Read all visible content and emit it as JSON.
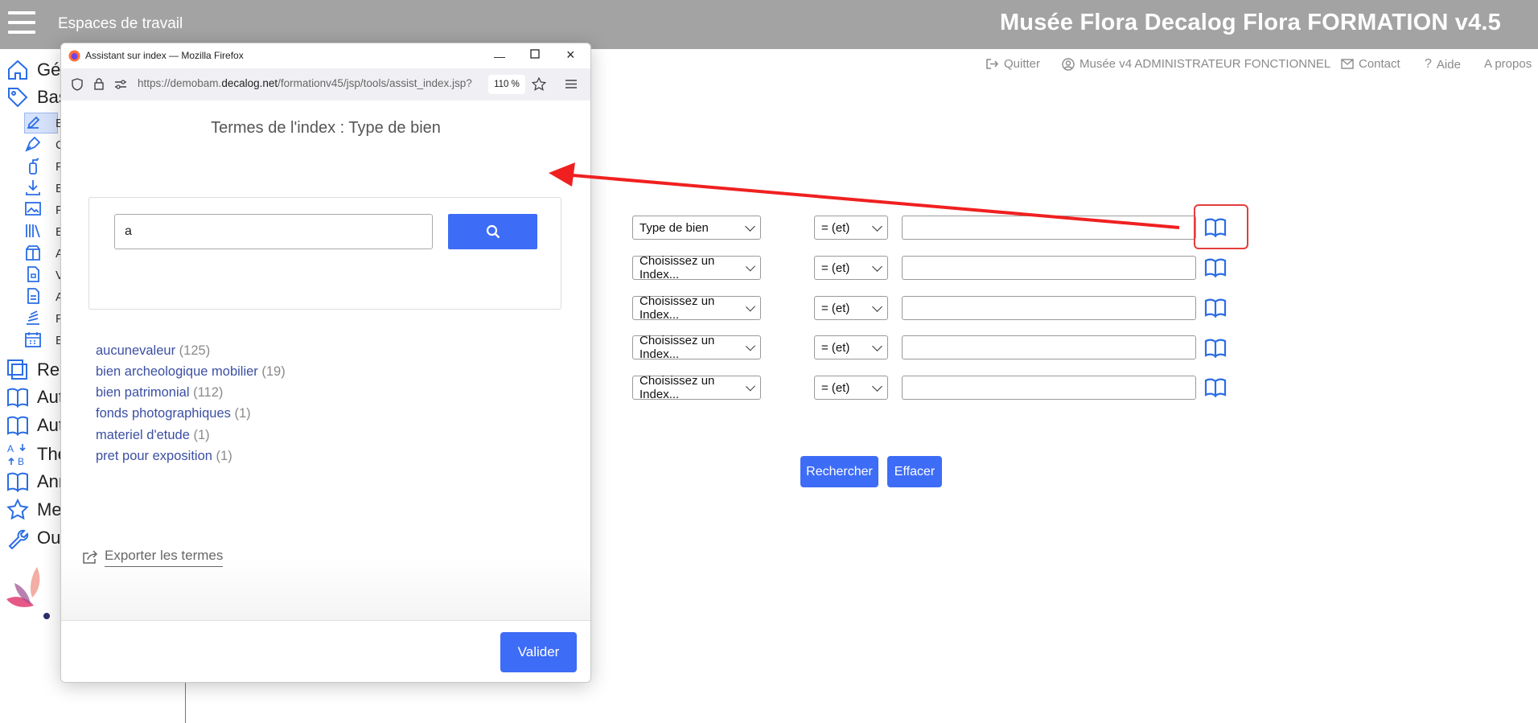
{
  "header": {
    "workspaces_label": "Espaces de travail",
    "app_title": "Musée Flora Decalog Flora FORMATION v4.5"
  },
  "toplinks": {
    "quit": "Quitter",
    "user": "Musée v4 ADMINISTRATEUR FONCTIONNEL",
    "contact": "Contact",
    "help": "Aide",
    "about": "A propos"
  },
  "sidebar": {
    "items": [
      {
        "label": "Gén",
        "icon": "home-icon"
      },
      {
        "label": "Bas",
        "icon": "tag-icon"
      },
      {
        "label": "Reg",
        "icon": "registers-icon"
      },
      {
        "label": "Aut",
        "icon": "book-icon"
      },
      {
        "label": "Aut",
        "icon": "book-icon"
      },
      {
        "label": "The",
        "icon": "sort-az-icon"
      },
      {
        "label": "Ann",
        "icon": "book-icon"
      },
      {
        "label": "Mes",
        "icon": "star-icon"
      },
      {
        "label": "Out",
        "icon": "wrench-icon"
      }
    ],
    "subitems": [
      "E",
      "C",
      "F",
      "E",
      "F",
      "E",
      "A",
      "V",
      "A",
      "F",
      "E"
    ]
  },
  "form": {
    "rows": [
      {
        "index": "Type de bien",
        "operator": "= (et)",
        "value": ""
      },
      {
        "index": "Choisissez un Index...",
        "operator": "= (et)",
        "value": ""
      },
      {
        "index": "Choisissez un Index...",
        "operator": "= (et)",
        "value": ""
      },
      {
        "index": "Choisissez un Index...",
        "operator": "= (et)",
        "value": ""
      },
      {
        "index": "Choisissez un Index...",
        "operator": "= (et)",
        "value": ""
      }
    ],
    "search_button": "Rechercher",
    "clear_button": "Effacer"
  },
  "popup": {
    "window_title": "Assistant sur index — Mozilla Firefox",
    "url_prefix": "https://demobam.",
    "url_domain": "decalog.net",
    "url_path": "/formationv45/jsp/tools/assist_index.jsp?",
    "zoom": "110 %",
    "heading": "Termes de l'index : Type de bien",
    "search_value": "a",
    "terms": [
      {
        "label": "aucunevaleur",
        "count": "(125)"
      },
      {
        "label": "bien archeologique mobilier",
        "count": "(19)"
      },
      {
        "label": "bien patrimonial",
        "count": "(112)"
      },
      {
        "label": "fonds photographiques",
        "count": "(1)"
      },
      {
        "label": "materiel d'etude",
        "count": "(1)"
      },
      {
        "label": "pret pour exposition",
        "count": "(1)"
      }
    ],
    "export_label": "Exporter les termes",
    "validate_button": "Valider"
  },
  "colors": {
    "header_bg": "#a3a3a3",
    "accent_blue": "#3d6cf6",
    "annotation_red": "#e43d3d"
  }
}
